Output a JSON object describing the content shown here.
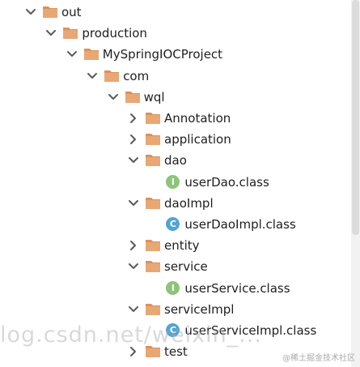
{
  "colors": {
    "folder": "#e8a773",
    "folder_tab": "#d9925d",
    "arrow": "#5a5a5a",
    "interface_badge": "#8dc479",
    "class_badge": "#51a5d4"
  },
  "tree": [
    {
      "label": "out",
      "arrow": "down",
      "icon": "folder-icon",
      "depth": 0
    },
    {
      "label": "production",
      "arrow": "down",
      "icon": "folder-icon",
      "depth": 1
    },
    {
      "label": "MySpringIOCProject",
      "arrow": "down",
      "icon": "folder-icon",
      "depth": 2
    },
    {
      "label": "com",
      "arrow": "down",
      "icon": "folder-icon",
      "depth": 3
    },
    {
      "label": "wql",
      "arrow": "down",
      "icon": "folder-icon",
      "depth": 4
    },
    {
      "label": "Annotation",
      "arrow": "right",
      "icon": "folder-icon",
      "depth": 5
    },
    {
      "label": "application",
      "arrow": "right",
      "icon": "folder-icon",
      "depth": 5
    },
    {
      "label": "dao",
      "arrow": "down",
      "icon": "folder-icon",
      "depth": 5
    },
    {
      "label": "userDao.class",
      "arrow": "none",
      "icon": "interface-icon",
      "badge": "I",
      "depth": 6
    },
    {
      "label": "daoImpl",
      "arrow": "down",
      "icon": "folder-icon",
      "depth": 5
    },
    {
      "label": "userDaoImpl.class",
      "arrow": "none",
      "icon": "class-icon",
      "badge": "C",
      "depth": 6
    },
    {
      "label": "entity",
      "arrow": "right",
      "icon": "folder-icon",
      "depth": 5
    },
    {
      "label": "service",
      "arrow": "down",
      "icon": "folder-icon",
      "depth": 5
    },
    {
      "label": "userService.class",
      "arrow": "none",
      "icon": "interface-icon",
      "badge": "I",
      "depth": 6
    },
    {
      "label": "serviceImpl",
      "arrow": "down",
      "icon": "folder-icon",
      "depth": 5
    },
    {
      "label": "userServiceImpl.class",
      "arrow": "none",
      "icon": "class-icon",
      "badge": "C",
      "depth": 6
    },
    {
      "label": "test",
      "arrow": "right",
      "icon": "folder-icon",
      "depth": 5
    }
  ],
  "watermark": "log.csdn.net/weixin_...",
  "credit": "@稀土掘金技术社区"
}
